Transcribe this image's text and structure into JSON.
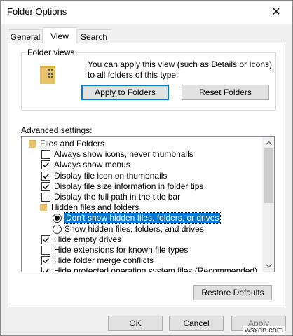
{
  "window": {
    "title": "Folder Options",
    "close_glyph": "✕"
  },
  "tabs": [
    {
      "label": "General",
      "active": false
    },
    {
      "label": "View",
      "active": true
    },
    {
      "label": "Search",
      "active": false
    }
  ],
  "folder_views": {
    "label": "Folder views",
    "description": "You can apply this view (such as Details or Icons) to all folders of this type.",
    "apply_button": "Apply to Folders",
    "reset_button": "Reset Folders"
  },
  "advanced": {
    "label": "Advanced settings:",
    "items": [
      {
        "type": "folder",
        "label": "Files and Folders"
      },
      {
        "type": "checkbox",
        "label": "Always show icons, never thumbnails",
        "checked": false
      },
      {
        "type": "checkbox",
        "label": "Always show menus",
        "checked": true
      },
      {
        "type": "checkbox",
        "label": "Display file icon on thumbnails",
        "checked": true
      },
      {
        "type": "checkbox",
        "label": "Display file size information in folder tips",
        "checked": true
      },
      {
        "type": "checkbox",
        "label": "Display the full path in the title bar",
        "checked": false
      },
      {
        "type": "folder",
        "label": "Hidden files and folders"
      },
      {
        "type": "radio",
        "label": "Don't show hidden files, folders, or drives",
        "checked": true,
        "selected": true
      },
      {
        "type": "radio",
        "label": "Show hidden files, folders, and drives",
        "checked": false
      },
      {
        "type": "checkbox",
        "label": "Hide empty drives",
        "checked": true
      },
      {
        "type": "checkbox",
        "label": "Hide extensions for known file types",
        "checked": false
      },
      {
        "type": "checkbox",
        "label": "Hide folder merge conflicts",
        "checked": true
      },
      {
        "type": "checkbox",
        "label": "Hide protected operating system files (Recommended)",
        "checked": true
      }
    ]
  },
  "buttons": {
    "restore_defaults": "Restore Defaults",
    "ok": "OK",
    "cancel": "Cancel",
    "apply": "Apply"
  },
  "watermark": "wsxdn.com",
  "colors": {
    "accent": "#0078d7",
    "folder": "#e8c36a"
  }
}
